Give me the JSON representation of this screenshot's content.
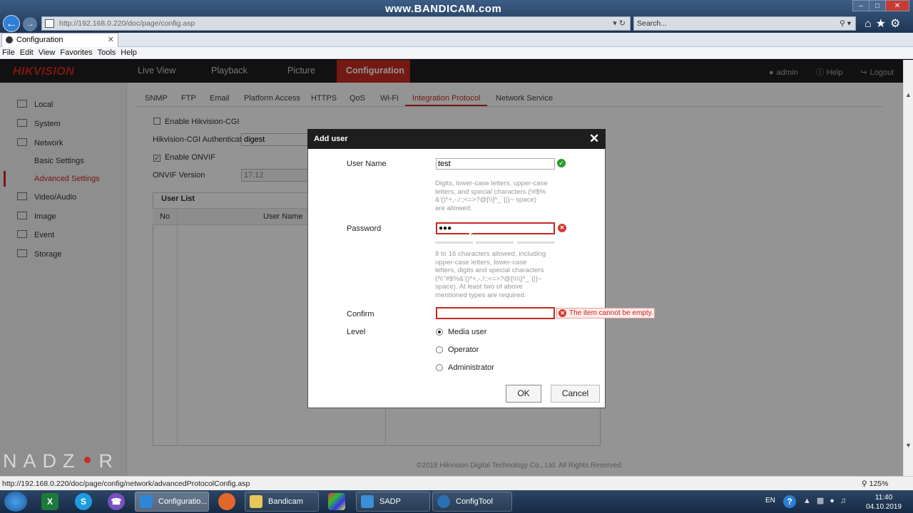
{
  "browser": {
    "address": "http://192.168.0.220/doc/page/config.asp",
    "search_placeholder": "Search...",
    "tab_title": "Configuration",
    "watermark": "www.BANDICAM.com",
    "menu": [
      "File",
      "Edit",
      "View",
      "Favorites",
      "Tools",
      "Help"
    ],
    "status_url": "http://192.168.0.220/doc/page/config/network/advancedProtocolConfig.asp",
    "zoom": "125%"
  },
  "header": {
    "logo": "HIKVISION",
    "nav": [
      "Live View",
      "Playback",
      "Picture",
      "Configuration"
    ],
    "user": "admin",
    "help": "Help",
    "logout": "Logout"
  },
  "left_nav": {
    "local": "Local",
    "system": "System",
    "network": "Network",
    "basic_settings": "Basic Settings",
    "advanced_settings": "Advanced Settings",
    "video_audio": "Video/Audio",
    "image": "Image",
    "event": "Event",
    "storage": "Storage"
  },
  "subtabs": [
    "SNMP",
    "FTP",
    "Email",
    "Platform Access",
    "HTTPS",
    "QoS",
    "Wi-Fi",
    "Integration Protocol",
    "Network Service"
  ],
  "form": {
    "enable_cgi": "Enable Hikvision-CGI",
    "cgi_auth_label": "Hikvision-CGI Authenticat",
    "cgi_auth_value": "digest",
    "enable_onvif": "Enable ONVIF",
    "onvif_version_label": "ONVIF Version",
    "onvif_version_value": "17.12",
    "user_list": "User List",
    "col_no": "No",
    "col_username": "User Name"
  },
  "copyright": "©2018 Hikvision Digital Technology Co., Ltd. All Rights Reserved.",
  "brand_watermark": {
    "left": "NADZ",
    "right": "R"
  },
  "dialog": {
    "title": "Add user",
    "username_label": "User Name",
    "username_value": "test",
    "username_hint": [
      "Digits, lower-case letters, upper-case",
      "letters, and special characters (!#$%",
      "&'()*+,-./:;<=>?@[\\\\]^_`{|}~ space)",
      "are allowed."
    ],
    "password_label": "Password",
    "password_value": "●●●",
    "password_hint": [
      "8 to 16 characters allowed, including",
      "upper-case letters, lower-case",
      "letters, digits and special characters",
      "(!\\\\\"#$%&'()*+,-./:;<=>?@[\\\\\\\\]^_`{|}~",
      "space). At least two of above",
      "mentioned types are required."
    ],
    "confirm_label": "Confirm",
    "confirm_error": "The item cannot be empty.",
    "level_label": "Level",
    "levels": [
      "Media user",
      "Operator",
      "Administrator"
    ],
    "ok": "OK",
    "cancel": "Cancel"
  },
  "taskbar": {
    "tasks": [
      "Configuratio...",
      "Bandicam",
      "SADP",
      "ConfigTool"
    ],
    "lang": "EN",
    "time": "11:40",
    "date": "04.10.2019"
  }
}
